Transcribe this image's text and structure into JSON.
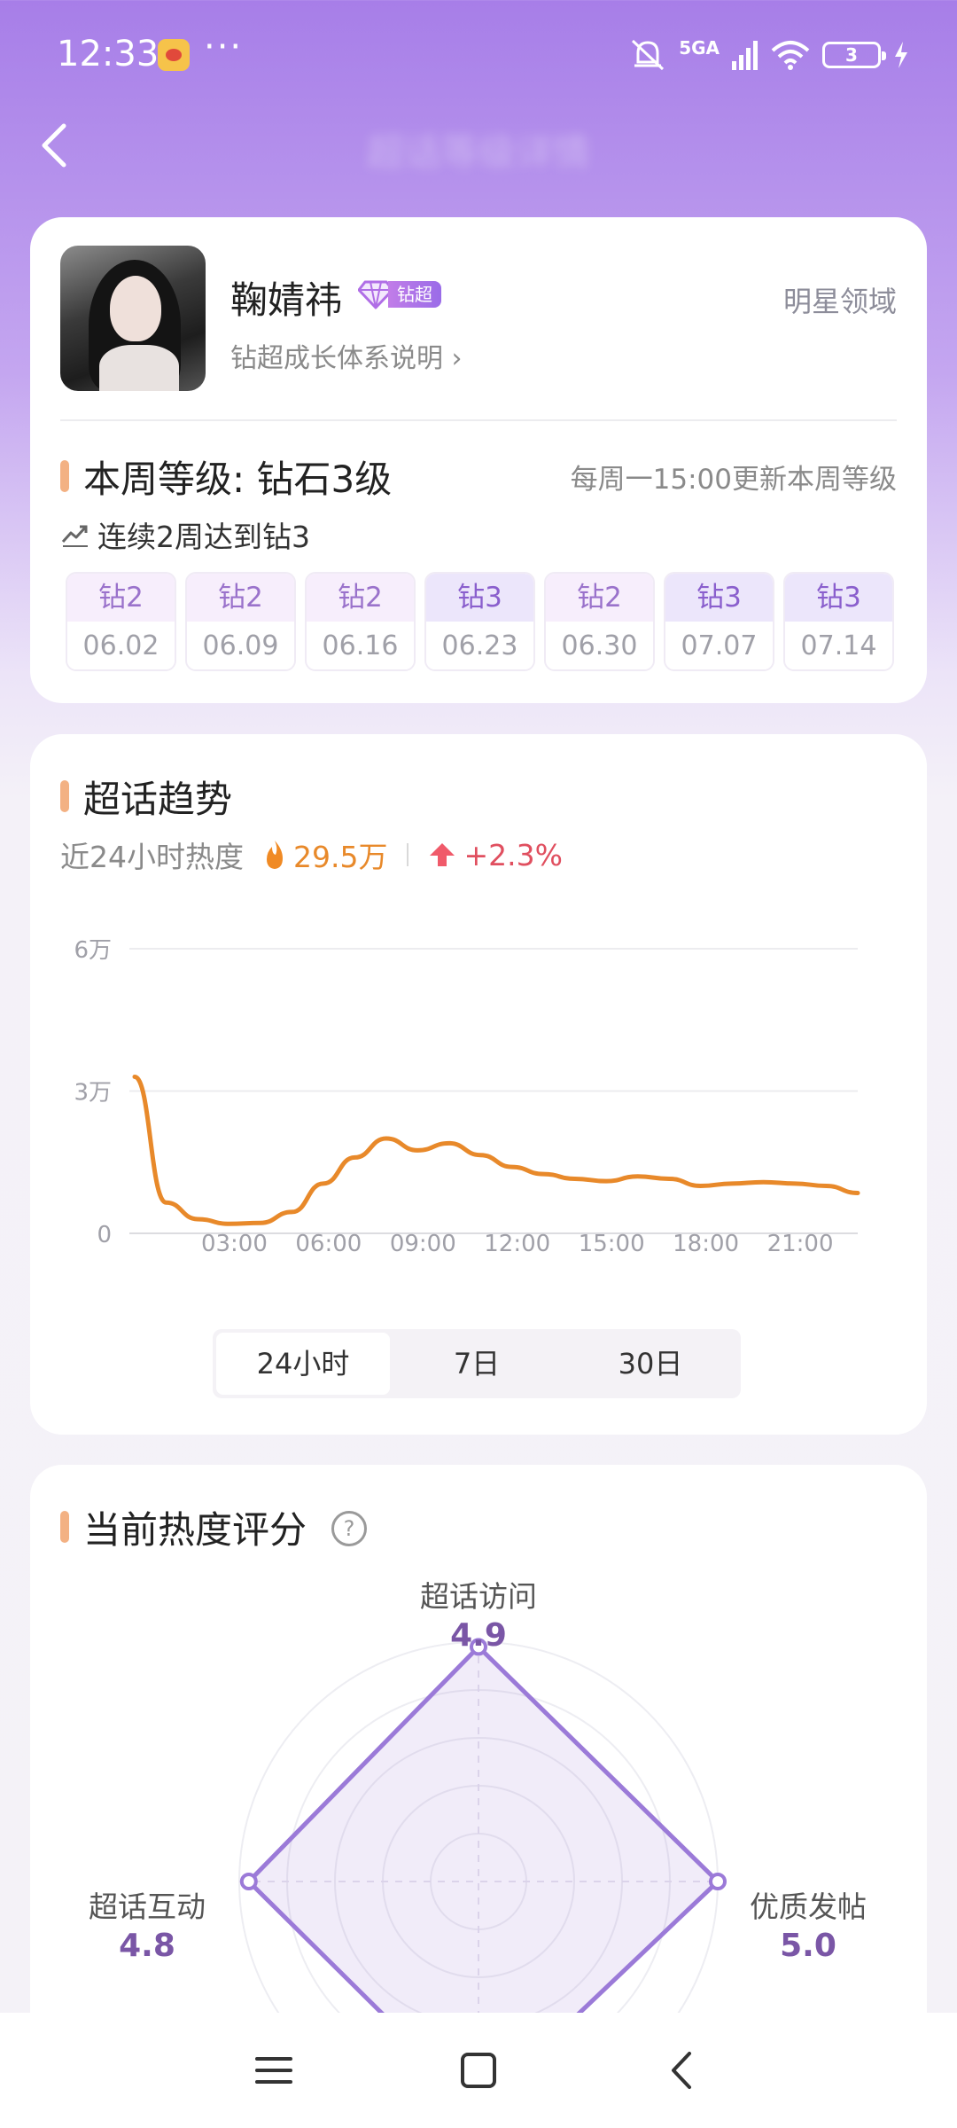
{
  "status_bar": {
    "time": "12:33",
    "more": "···",
    "network": "5GA",
    "battery": "3"
  },
  "header": {
    "title": "超话等级详情"
  },
  "profile": {
    "name": "鞠婧祎",
    "badge": "钻超",
    "growth_link": "钻超成长体系说明 ›",
    "domain": "明星领域"
  },
  "weekly": {
    "level_title": "本周等级: 钻石3级",
    "update_note": "每周一15:00更新本周等级",
    "streak": "连续2周达到钻3",
    "weeks": [
      {
        "level": "钻2",
        "date": "06.02"
      },
      {
        "level": "钻2",
        "date": "06.09"
      },
      {
        "level": "钻2",
        "date": "06.16"
      },
      {
        "level": "钻3",
        "date": "06.23"
      },
      {
        "level": "钻2",
        "date": "06.30"
      },
      {
        "level": "钻3",
        "date": "07.07"
      },
      {
        "level": "钻3",
        "date": "07.14"
      }
    ]
  },
  "trend": {
    "title": "超话趋势",
    "heat_label": "近24小时热度",
    "heat_value": "29.5万",
    "heat_change": "+2.3%",
    "tabs": [
      "24小时",
      "7日",
      "30日"
    ],
    "active_tab": "24小时"
  },
  "chart_data": {
    "type": "line",
    "x": [
      0,
      1,
      2,
      3,
      4,
      5,
      6,
      7,
      8,
      9,
      10,
      11,
      12,
      13,
      14,
      15,
      16,
      17,
      18,
      19,
      20,
      21,
      22,
      23
    ],
    "y": [
      33000,
      6500,
      3000,
      2000,
      2200,
      4500,
      10500,
      16000,
      20000,
      17500,
      19000,
      16500,
      14000,
      12500,
      11500,
      11000,
      12000,
      11500,
      10000,
      10500,
      10800,
      10500,
      10000,
      8500
    ],
    "xticks": [
      "03:00",
      "06:00",
      "09:00",
      "12:00",
      "15:00",
      "18:00",
      "21:00"
    ],
    "yticks": [
      "0",
      "3万",
      "6万"
    ],
    "ylim": [
      0,
      60000
    ],
    "grid": true,
    "color": "#e8892a"
  },
  "score": {
    "title": "当前热度评分",
    "help": "?",
    "axes": [
      {
        "label": "超话访问",
        "value": "4.9"
      },
      {
        "label": "优质发帖",
        "value": "5.0"
      },
      {
        "label": "超话互动",
        "value": "4.8"
      }
    ],
    "max": 5
  },
  "colors": {
    "accent": "#7a56a6",
    "header_gradient": "#a77ee8",
    "line": "#e8892a",
    "radar": "#9b7ad8"
  }
}
